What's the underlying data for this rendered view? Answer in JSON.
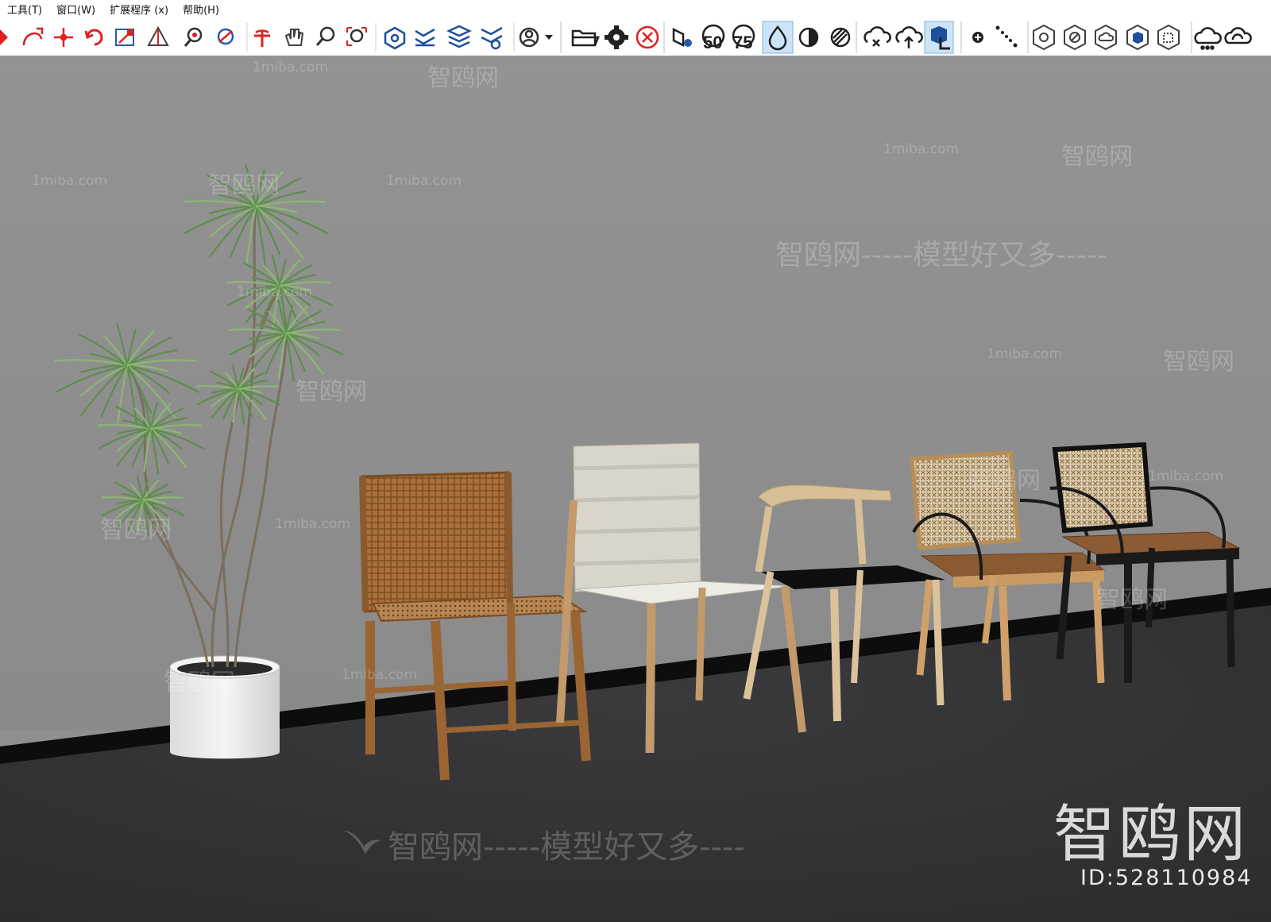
{
  "menus": [
    "工具(T)",
    "窗口(W)",
    "扩展程序 (x)",
    "帮助(H)"
  ],
  "toolbar": {
    "tools": [
      "select-arrow-icon",
      "follow-me-icon",
      "move-icon",
      "rotate-icon",
      "scale-icon",
      "protractor-icon",
      "zoom-extents-icon",
      "orbit-icon",
      "pan-icon",
      "hand-icon",
      "zoom-icon",
      "zoom-window-icon",
      "component-icon",
      "section-icon",
      "layers-icon",
      "styles-icon",
      "user-icon",
      "dropdown-arrow-icon",
      "open-folder-icon",
      "settings-gear-icon",
      "close-circle-icon",
      "render-icon",
      "quality-50-icon",
      "quality-75-icon",
      "water-drop-icon",
      "contrast-icon",
      "hatch-icon",
      "cloud-x-icon",
      "cloud-upload-icon",
      "cube-hand-icon",
      "add-dot-icon",
      "dotted-line-icon",
      "hex-rotate-icon",
      "hex-slash-icon",
      "hex-cloud-icon",
      "hex-cube-icon",
      "hex-box-icon",
      "cloud-dots-icon",
      "cloud-sync-icon"
    ],
    "labels": {
      "q50": "50",
      "q75": "75"
    }
  },
  "watermarks": {
    "site": "1miba.com",
    "brand": "智鸥网",
    "slogan": "智鸥网-----模型好又多-----",
    "slogan_bottom": "智鸥网-----模型好又多----",
    "big_brand": "智鸥网",
    "id_label": "ID:528110984"
  },
  "scene": {
    "wall_color": "#8f8f8f",
    "floor_color": "#333336",
    "baseboard_color": "#0d0d0d"
  }
}
